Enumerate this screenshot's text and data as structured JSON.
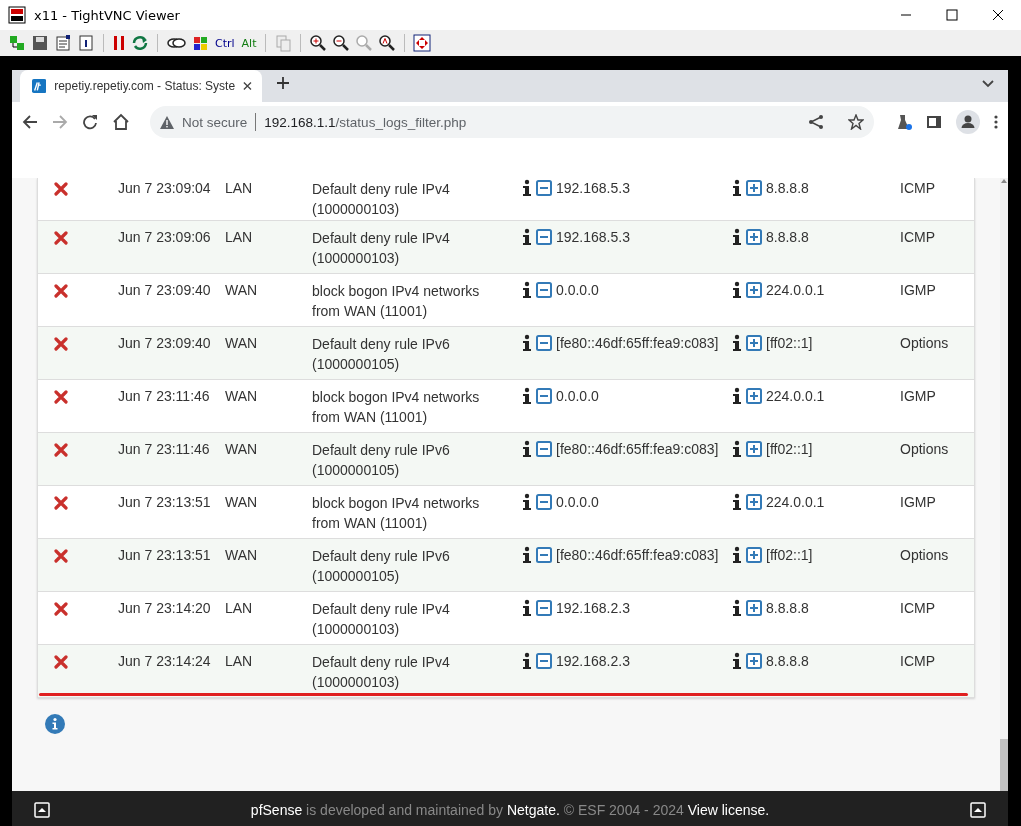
{
  "window": {
    "title": "x11 - TightVNC Viewer"
  },
  "vnc_toolbar": {
    "ctrl_key": "Ctrl",
    "alt_key": "Alt"
  },
  "browser": {
    "tab": {
      "title": "repetiy.repetiy.com - Status: Syste"
    },
    "address": {
      "security": "Not secure",
      "host": "192.168.1.1",
      "path": "/status_logs_filter.php"
    }
  },
  "log_table": {
    "rows": [
      {
        "kind": "block",
        "time": "Jun 7 23:09:04",
        "interface": "LAN",
        "rule": "Default deny rule IPv4 (1000000103)",
        "source": "192.168.5.3",
        "destination": "8.8.8.8",
        "protocol": "ICMP"
      },
      {
        "kind": "block",
        "time": "Jun 7 23:09:06",
        "interface": "LAN",
        "rule": "Default deny rule IPv4 (1000000103)",
        "source": "192.168.5.3",
        "destination": "8.8.8.8",
        "protocol": "ICMP"
      },
      {
        "kind": "block",
        "time": "Jun 7 23:09:40",
        "interface": "WAN",
        "rule": "block bogon IPv4 networks from WAN (11001)",
        "source": "0.0.0.0",
        "destination": "224.0.0.1",
        "protocol": "IGMP"
      },
      {
        "kind": "block",
        "time": "Jun 7 23:09:40",
        "interface": "WAN",
        "rule": "Default deny rule IPv6 (1000000105)",
        "source": "[fe80::46df:65ff:fea9:c083]",
        "destination": "[ff02::1]",
        "protocol": "Options"
      },
      {
        "kind": "block",
        "time": "Jun 7 23:11:46",
        "interface": "WAN",
        "rule": "block bogon IPv4 networks from WAN (11001)",
        "source": "0.0.0.0",
        "destination": "224.0.0.1",
        "protocol": "IGMP"
      },
      {
        "kind": "block",
        "time": "Jun 7 23:11:46",
        "interface": "WAN",
        "rule": "Default deny rule IPv6 (1000000105)",
        "source": "[fe80::46df:65ff:fea9:c083]",
        "destination": "[ff02::1]",
        "protocol": "Options"
      },
      {
        "kind": "block",
        "time": "Jun 7 23:13:51",
        "interface": "WAN",
        "rule": "block bogon IPv4 networks from WAN (11001)",
        "source": "0.0.0.0",
        "destination": "224.0.0.1",
        "protocol": "IGMP"
      },
      {
        "kind": "block",
        "time": "Jun 7 23:13:51",
        "interface": "WAN",
        "rule": "Default deny rule IPv6 (1000000105)",
        "source": "[fe80::46df:65ff:fea9:c083]",
        "destination": "[ff02::1]",
        "protocol": "Options"
      },
      {
        "kind": "block",
        "time": "Jun 7 23:14:20",
        "interface": "LAN",
        "rule": "Default deny rule IPv4 (1000000103)",
        "source": "192.168.2.3",
        "destination": "8.8.8.8",
        "protocol": "ICMP"
      },
      {
        "kind": "block",
        "time": "Jun 7 23:14:24",
        "interface": "LAN",
        "rule": "Default deny rule IPv4 (1000000103)",
        "source": "192.168.2.3",
        "destination": "8.8.8.8",
        "protocol": "ICMP"
      }
    ]
  },
  "footer": {
    "product": "pfSense",
    "middle": " is developed and maintained by ",
    "company": "Netgate.",
    "copyright": " © ESF 2004 - 2024 ",
    "license_link": "View license."
  }
}
